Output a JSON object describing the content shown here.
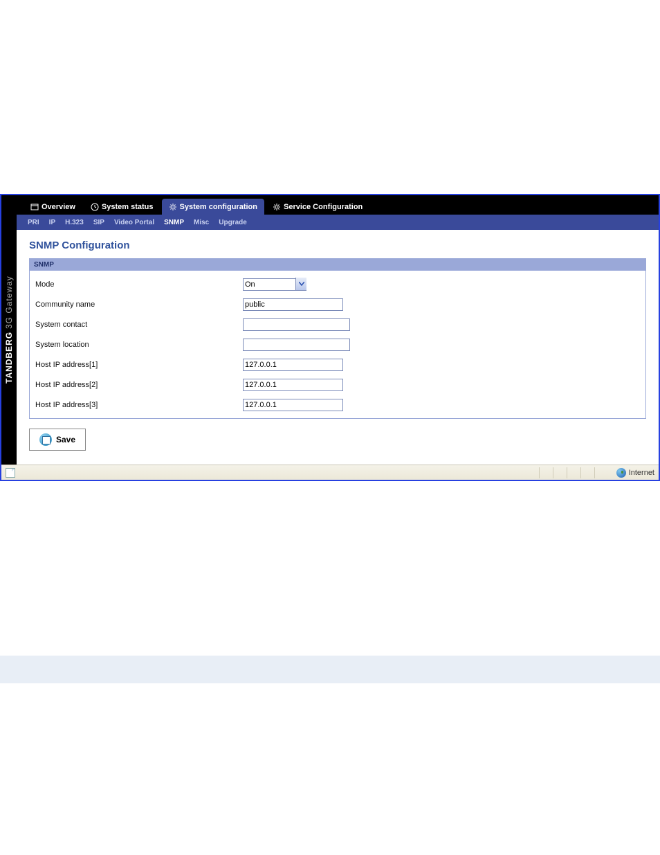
{
  "sidebar": {
    "brand_bold": "TANDBERG",
    "brand_light": "3G Gateway"
  },
  "tabs": [
    {
      "label": "Overview"
    },
    {
      "label": "System status"
    },
    {
      "label": "System configuration"
    },
    {
      "label": "Service Configuration"
    }
  ],
  "subnav": [
    {
      "label": "PRI"
    },
    {
      "label": "IP"
    },
    {
      "label": "H.323"
    },
    {
      "label": "SIP"
    },
    {
      "label": "Video Portal"
    },
    {
      "label": "SNMP"
    },
    {
      "label": "Misc"
    },
    {
      "label": "Upgrade"
    }
  ],
  "page_title": "SNMP Configuration",
  "panel": {
    "header": "SNMP",
    "fields": {
      "mode_label": "Mode",
      "mode_value": "On",
      "community_label": "Community name",
      "community_value": "public",
      "contact_label": "System contact",
      "contact_value": "",
      "location_label": "System location",
      "location_value": "",
      "host1_label": "Host IP address[1]",
      "host1_value": "127.0.0.1",
      "host2_label": "Host IP address[2]",
      "host2_value": "127.0.0.1",
      "host3_label": "Host IP address[3]",
      "host3_value": "127.0.0.1"
    }
  },
  "save_label": "Save",
  "status": {
    "zone": "Internet"
  }
}
